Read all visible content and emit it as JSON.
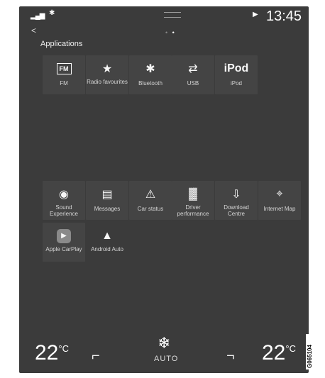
{
  "status_bar": {
    "signal": "▂▄▆",
    "bluetooth": "✱",
    "play": "▶",
    "time": "13:45"
  },
  "nav": {
    "back": "<",
    "pager_dots": [
      "•",
      "•"
    ]
  },
  "section_title": "Applications",
  "apps": [
    {
      "label": "FM",
      "icon": "radio-fm-icon",
      "glyph": "FM"
    },
    {
      "label": "Radio favourites",
      "icon": "radio-star-icon",
      "glyph": "★"
    },
    {
      "label": "Bluetooth",
      "icon": "bluetooth-icon",
      "glyph": "✱"
    },
    {
      "label": "USB",
      "icon": "usb-icon",
      "glyph": "⇄"
    },
    {
      "label": "iPod",
      "icon": "ipod-icon",
      "glyph": "iPod"
    },
    {
      "label": "Sound Experience",
      "icon": "speaker-icon",
      "glyph": "◉"
    },
    {
      "label": "Messages",
      "icon": "messages-icon",
      "glyph": "▤"
    },
    {
      "label": "Car status",
      "icon": "car-status-warning-icon",
      "glyph": "⚠"
    },
    {
      "label": "Driver performance",
      "icon": "driver-performance-icon",
      "glyph": "▓"
    },
    {
      "label": "Download Centre",
      "icon": "download-icon",
      "glyph": "⇩"
    },
    {
      "label": "Internet Map",
      "icon": "internet-map-icon",
      "glyph": "⌖"
    },
    {
      "label": "Apple CarPlay",
      "icon": "carplay-icon",
      "glyph": "▶"
    },
    {
      "label": "Android Auto",
      "icon": "android-auto-icon",
      "glyph": "▲"
    }
  ],
  "climate": {
    "left_temp": "22",
    "right_temp": "22",
    "unit": "°C",
    "fan_glyph": "❄",
    "mode": "AUTO",
    "seat_glyph": "⌐"
  },
  "image_code": "G065104"
}
